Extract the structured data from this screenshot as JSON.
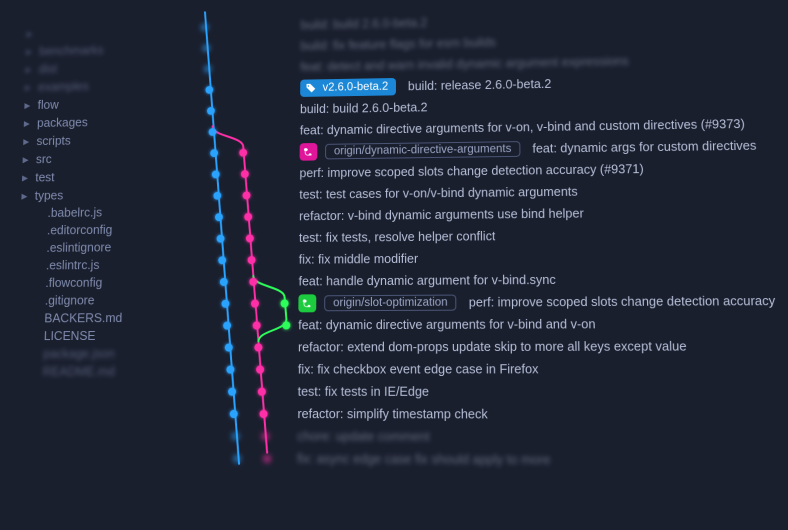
{
  "colors": {
    "accent_blue": "#2aa3ff",
    "accent_pink": "#ff2fa8",
    "accent_green": "#2dff5a",
    "bg": "#1a1f2e"
  },
  "sidebar": {
    "items": [
      {
        "label": "",
        "kind": "folder",
        "blurred": true
      },
      {
        "label": "benchmarks",
        "kind": "folder",
        "blurred": true
      },
      {
        "label": "dist",
        "kind": "folder",
        "blurred": true
      },
      {
        "label": "examples",
        "kind": "folder",
        "blurred": true
      },
      {
        "label": "flow",
        "kind": "folder"
      },
      {
        "label": "packages",
        "kind": "folder"
      },
      {
        "label": "scripts",
        "kind": "folder"
      },
      {
        "label": "src",
        "kind": "folder"
      },
      {
        "label": "test",
        "kind": "folder"
      },
      {
        "label": "types",
        "kind": "folder"
      },
      {
        "label": ".babelrc.js",
        "kind": "file",
        "indent": 1
      },
      {
        "label": ".editorconfig",
        "kind": "file",
        "indent": 1
      },
      {
        "label": ".eslintignore",
        "kind": "file",
        "indent": 1
      },
      {
        "label": ".eslintrc.js",
        "kind": "file",
        "indent": 1
      },
      {
        "label": ".flowconfig",
        "kind": "file",
        "indent": 1
      },
      {
        "label": ".gitignore",
        "kind": "file",
        "indent": 1
      },
      {
        "label": "BACKERS.md",
        "kind": "file",
        "indent": 1
      },
      {
        "label": "LICENSE",
        "kind": "file",
        "indent": 1
      },
      {
        "label": "package.json",
        "kind": "file",
        "indent": 1,
        "blurred": true
      },
      {
        "label": "README.md",
        "kind": "file",
        "indent": 1,
        "blurred": true
      }
    ]
  },
  "commits": [
    {
      "msg": "build: build 2.6.0-beta.2",
      "lanes": [
        "blue"
      ],
      "blurred": true
    },
    {
      "msg": "build: fix feature flags for esm builds",
      "lanes": [
        "blue"
      ],
      "blurred": true
    },
    {
      "msg": "feat: detect and warn invalid dynamic argument expressions",
      "lanes": [
        "blue"
      ],
      "blurred": true
    },
    {
      "msg": "build: release 2.6.0-beta.2",
      "lanes": [
        "blue"
      ],
      "badge": {
        "color": "blue",
        "icon": "tag",
        "text": "v2.6.0-beta.2"
      }
    },
    {
      "msg": "build: build 2.6.0-beta.2",
      "lanes": [
        "blue"
      ]
    },
    {
      "msg": "feat: dynamic directive arguments for v-on, v-bind and custom directives (#9373)",
      "lanes": [
        "blue"
      ]
    },
    {
      "msg": "feat: dynamic args for custom directives",
      "lanes": [
        "blue",
        "pink"
      ],
      "pink_branch_start": true,
      "badge": {
        "color": "pink",
        "icon": "branch",
        "text": "origin/dynamic-directive-arguments",
        "outline": true
      }
    },
    {
      "msg": "perf: improve scoped slots change detection accuracy (#9371)",
      "lanes": [
        "blue",
        "pink"
      ]
    },
    {
      "msg": "test: test cases for v-on/v-bind dynamic arguments",
      "lanes": [
        "blue",
        "pink"
      ]
    },
    {
      "msg": "refactor: v-bind dynamic arguments use bind helper",
      "lanes": [
        "blue",
        "pink"
      ]
    },
    {
      "msg": "test: fix tests, resolve helper conflict",
      "lanes": [
        "blue",
        "pink"
      ]
    },
    {
      "msg": "fix: fix middle modifier",
      "lanes": [
        "blue",
        "pink"
      ]
    },
    {
      "msg": "feat: handle dynamic argument for v-bind.sync",
      "lanes": [
        "blue",
        "pink"
      ]
    },
    {
      "msg": "perf: improve scoped slots change detection accuracy",
      "lanes": [
        "blue",
        "pink",
        "green"
      ],
      "green_branch_start": true,
      "badge": {
        "color": "green",
        "icon": "branch",
        "text": "origin/slot-optimization",
        "outline": true
      }
    },
    {
      "msg": "feat: dynamic directive arguments for v-bind and v-on",
      "lanes": [
        "blue",
        "pink",
        "green"
      ]
    },
    {
      "msg": "refactor: extend dom-props update skip to more all keys except value",
      "lanes": [
        "blue",
        "pink"
      ]
    },
    {
      "msg": "fix: fix checkbox event edge case in Firefox",
      "lanes": [
        "blue",
        "pink"
      ]
    },
    {
      "msg": "test: fix tests in IE/Edge",
      "lanes": [
        "blue",
        "pink"
      ]
    },
    {
      "msg": "refactor: simplify timestamp check",
      "lanes": [
        "blue",
        "pink"
      ]
    },
    {
      "msg": "chore: update comment",
      "lanes": [
        "blue",
        "pink"
      ],
      "blurred": true
    },
    {
      "msg": "fix: async edge case fix should apply to more",
      "lanes": [
        "blue",
        "pink"
      ],
      "blurred": true
    }
  ]
}
